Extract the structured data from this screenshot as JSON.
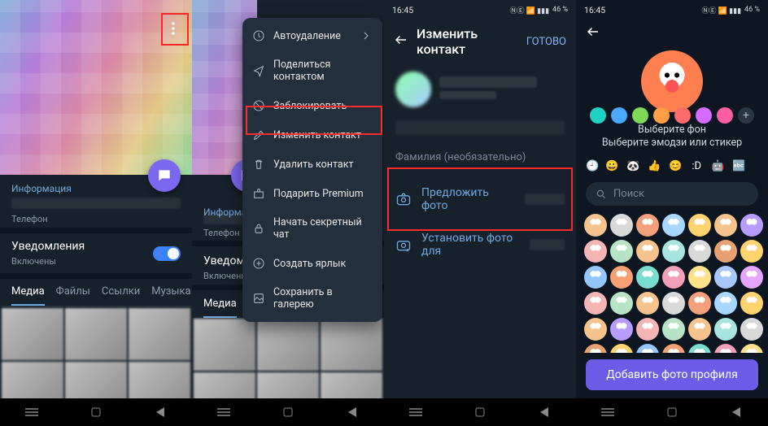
{
  "status": {
    "time": "16:45",
    "battery": "46 %"
  },
  "s1": {
    "info_label": "Информация",
    "phone_label": "Телефон",
    "notifications": "Уведомления",
    "notif_state": "Включены",
    "tabs": {
      "media": "Медиа",
      "files": "Файлы",
      "links": "Ссылки",
      "music": "Музыка"
    }
  },
  "menu": {
    "autodelete": "Автоудаление",
    "share": "Поделиться контактом",
    "block": "Заблокировать",
    "edit": "Изменить контакт",
    "delete": "Удалить контакт",
    "gift": "Подарить Premium",
    "secret": "Начать секретный чат",
    "shortcut": "Создать ярлык",
    "save_gallery": "Сохранить в галерею"
  },
  "s3": {
    "title": "Изменить контакт",
    "done": "ГОТОВО",
    "lastname": "Фамилия (необязательно)",
    "suggest": "Предложить фото",
    "set_for": "Установить фото для"
  },
  "s4": {
    "bg_label": "Выберите фон",
    "emoji_label": "Выберите эмодзи или стикер",
    "search": "Поиск",
    "add_profile": "Добавить фото профиля",
    "colors": [
      "#1fd2c4",
      "#4aa8ff",
      "#7ed957",
      "#ff9f43",
      "#ff6b6b",
      "#d56bff",
      "#ff5fa2"
    ],
    "chip_emojis": [
      "😀",
      "🐼",
      "👍",
      "😊",
      ":D",
      "🤖",
      "🔤"
    ],
    "sticker_colors": [
      "#f4c28a",
      "#d9d9d9",
      "#f29f7a",
      "#a8d8ff",
      "#ffd36e",
      "#f4c28a",
      "#b99cff",
      "#f6b5b5",
      "#b7e4c7",
      "#f4c28a",
      "#a7e6e0",
      "#d9d9d9",
      "#e89f71",
      "#ffd36e",
      "#93c6ff",
      "#f7a072",
      "#7adbd0",
      "#f29fb7",
      "#ffe28a",
      "#a7c7ff",
      "#e6a6ff",
      "#f6b5b5",
      "#b7e4c7",
      "#f4c28a",
      "#d9d9d9",
      "#f29f7a",
      "#a8d8ff",
      "#ffd36e",
      "#f4c28a",
      "#b99cff",
      "#f6b5b5",
      "#b7e4c7",
      "#f4c28a",
      "#a7e6e0",
      "#d9d9d9",
      "#e89f71",
      "#ffd36e",
      "#93c6ff",
      "#f7a072",
      "#7adbd0",
      "#f29fb7",
      "#ffe28a"
    ]
  }
}
